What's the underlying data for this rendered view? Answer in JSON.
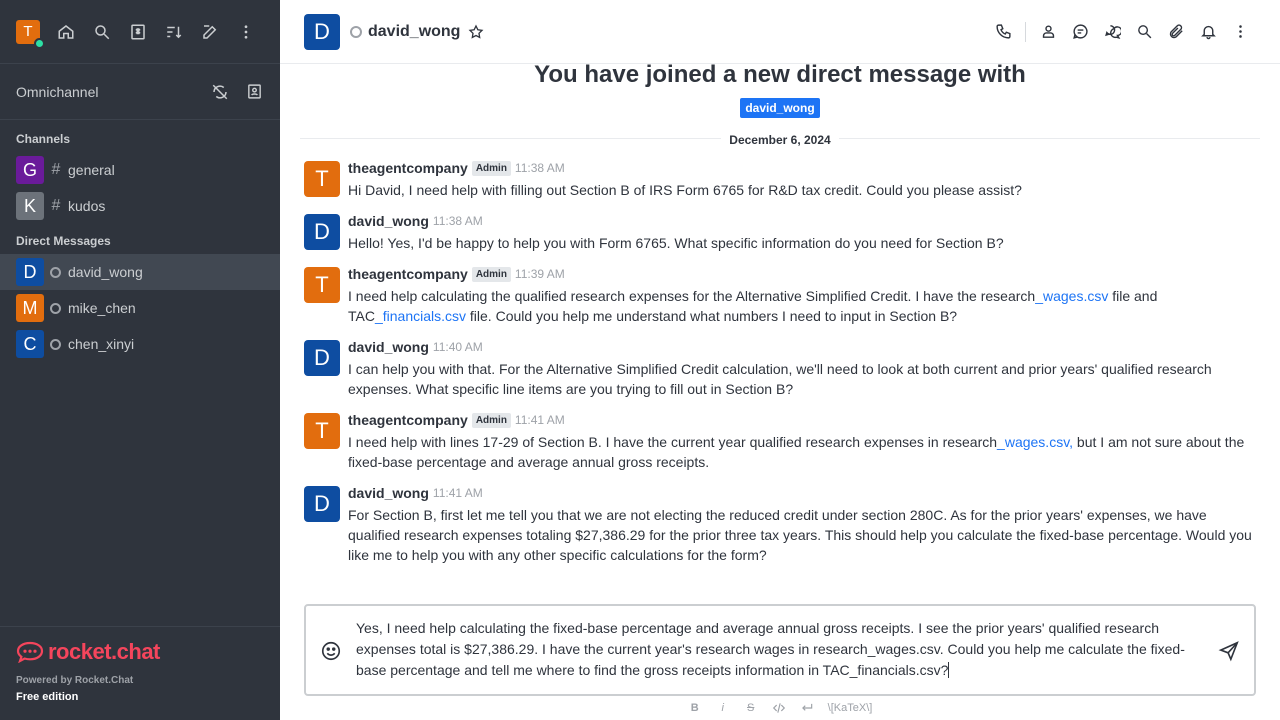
{
  "sidebar": {
    "user_initial": "T",
    "omnichannel_label": "Omnichannel",
    "channels_title": "Channels",
    "channels": [
      {
        "initial": "G",
        "name": "general",
        "color": "#6a1b9a"
      },
      {
        "initial": "K",
        "name": "kudos",
        "color": "#6c727a"
      }
    ],
    "dm_title": "Direct Messages",
    "dms": [
      {
        "initial": "D",
        "name": "david_wong",
        "color": "#0e4da1"
      },
      {
        "initial": "M",
        "name": "mike_chen",
        "color": "#e26d0e"
      },
      {
        "initial": "C",
        "name": "chen_xinyi",
        "color": "#0e4da1"
      }
    ],
    "footer": {
      "logo_text": "rocket.chat",
      "powered": "Powered by Rocket.Chat",
      "edition": "Free edition"
    }
  },
  "header": {
    "avatar_initial": "D",
    "room_name": "david_wong"
  },
  "main": {
    "joined_text": "You have joined a new direct message with",
    "joined_user": "david_wong",
    "date_divider": "December 6, 2024",
    "messages": [
      {
        "initial": "T",
        "color": "#e26d0e",
        "user": "theagentcompany",
        "badge": "Admin",
        "time": "11:38 AM",
        "text": "Hi David, I need help with filling out Section B of IRS Form 6765 for R&D tax credit. Could you please assist?"
      },
      {
        "initial": "D",
        "color": "#0e4da1",
        "user": "david_wong",
        "badge": "",
        "time": "11:38 AM",
        "text": "Hello! Yes, I'd be happy to help you with Form 6765. What specific information do you need for Section B?"
      },
      {
        "initial": "T",
        "color": "#e26d0e",
        "user": "theagentcompany",
        "badge": "Admin",
        "time": "11:39 AM",
        "text_parts": [
          "I need help calculating the qualified research expenses for the Alternative Simplified Credit. I have the research",
          "_wages.csv",
          " file and TAC",
          "_financials.csv",
          " file. Could you help me understand what numbers I need to input in Section B?"
        ]
      },
      {
        "initial": "D",
        "color": "#0e4da1",
        "user": "david_wong",
        "badge": "",
        "time": "11:40 AM",
        "text": "I can help you with that. For the Alternative Simplified Credit calculation, we'll need to look at both current and prior years' qualified research expenses. What specific line items are you trying to fill out in Section B?"
      },
      {
        "initial": "T",
        "color": "#e26d0e",
        "user": "theagentcompany",
        "badge": "Admin",
        "time": "11:41 AM",
        "text_parts": [
          "I need help with lines 17-29 of Section B. I have the current year qualified research expenses in research",
          "_wages.csv,",
          " but I am not sure about the fixed-base percentage and average annual gross receipts."
        ]
      },
      {
        "initial": "D",
        "color": "#0e4da1",
        "user": "david_wong",
        "badge": "",
        "time": "11:41 AM",
        "text": "For Section B, first let me tell you that we are not electing the reduced credit under section 280C. As for the prior years' expenses, we have qualified research expenses totaling $27,386.29 for the prior three tax years. This should help you calculate the fixed-base percentage. Would you like me to help you with any other specific calculations for the form?"
      }
    ]
  },
  "composer": {
    "text": "Yes, I need help calculating the fixed-base percentage and average annual gross receipts. I see the prior years' qualified research expenses total is $27,386.29. I have the current year's research wages in research_wages.csv. Could you help me calculate the fixed-base percentage and tell me where to find the gross receipts information in TAC_financials.csv?",
    "toolbar": {
      "bold": "B",
      "italic": "i",
      "strike": "S",
      "katex": "\\[KaTeX\\]"
    }
  }
}
